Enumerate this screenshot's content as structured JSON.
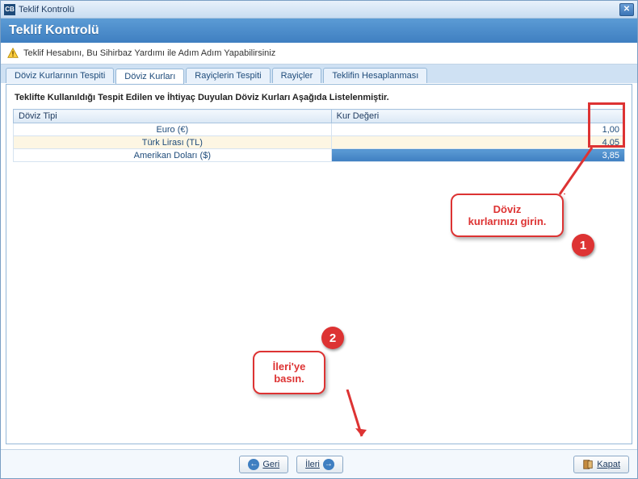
{
  "window": {
    "title": "Teklif Kontrolü",
    "app_icon_text": "CB"
  },
  "header": {
    "title": "Teklif Kontrolü"
  },
  "info": {
    "text": "Teklif Hesabını,  Bu Sihirbaz Yardımı ile Adım Adım Yapabilirsiniz"
  },
  "tabs": {
    "items": [
      {
        "label": "Döviz Kurlarının Tespiti"
      },
      {
        "label": "Döviz Kurları"
      },
      {
        "label": "Rayiçlerin Tespiti"
      },
      {
        "label": "Rayiçler"
      },
      {
        "label": "Teklifin Hesaplanması"
      }
    ],
    "active_index": 1
  },
  "content": {
    "description": "Teklifte Kullanıldığı Tespit Edilen ve İhtiyaç Duyulan Döviz Kurları Aşağıda Listelenmiştir.",
    "columns": {
      "type": "Döviz Tipi",
      "value": "Kur Değeri"
    },
    "rows": [
      {
        "name": "Euro (€)",
        "value": "1,00"
      },
      {
        "name": "Türk Lirası (TL)",
        "value": "4,05"
      },
      {
        "name": "Amerikan Doları ($)",
        "value": "3,85"
      }
    ]
  },
  "annotations": {
    "callout1": {
      "text": "Döviz\nkurlarınızı girin.",
      "num": "1"
    },
    "callout2": {
      "text": "İleri'ye\nbasın.",
      "num": "2"
    }
  },
  "footer": {
    "back": "Geri",
    "next": "İleri",
    "close": "Kapat"
  }
}
